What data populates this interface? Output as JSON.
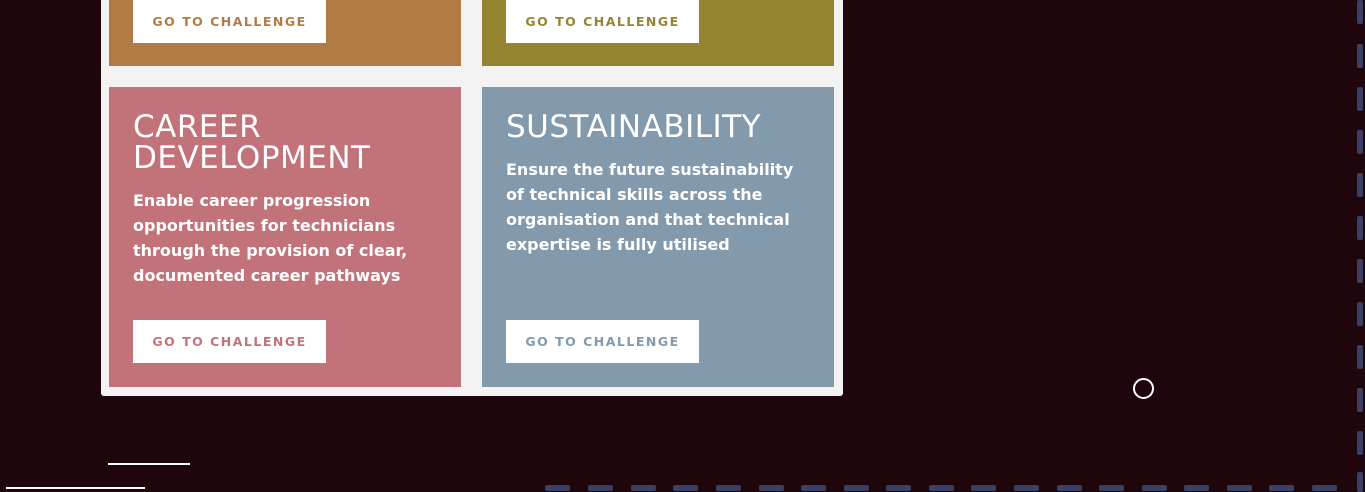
{
  "cards": [
    {
      "id": "top-left",
      "button_label": "GO TO CHALLENGE",
      "color": "#b27b44"
    },
    {
      "id": "top-right",
      "button_label": "GO TO CHALLENGE",
      "color": "#958530"
    },
    {
      "id": "career-development",
      "title": "CAREER\nDEVELOPMENT",
      "description": "Enable career progression opportunities for technicians through the provision of clear, documented career pathways",
      "button_label": "GO TO CHALLENGE",
      "color": "#c2737a"
    },
    {
      "id": "sustainability",
      "title": "SUSTAINABILITY",
      "description": "Ensure the future sustainability of technical skills across the organisation and that technical expertise is fully utilised",
      "button_label": "GO TO CHALLENGE",
      "color": "#8399ac"
    }
  ],
  "colors": {
    "background": "#1f060d",
    "panel": "#f3f3f3",
    "scroll_marker": "#3a3f63"
  }
}
